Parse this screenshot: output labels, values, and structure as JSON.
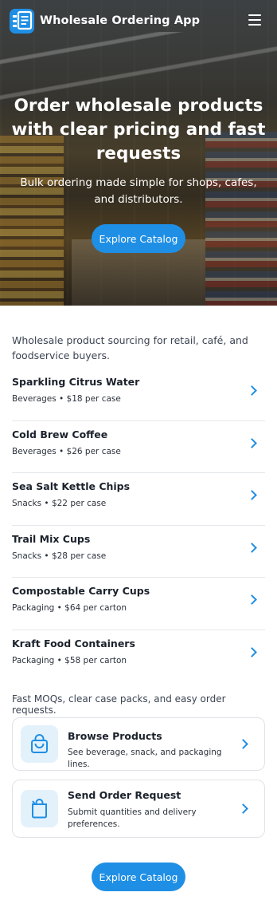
{
  "header": {
    "title": "Wholesale Ordering App",
    "logo_icon": "list-document-icon",
    "menu_icon": "hamburger-menu-icon"
  },
  "hero": {
    "title": "Order wholesale products with clear pricing and fast requests",
    "subtitle": "Bulk ordering made simple for shops, cafes, and distributors.",
    "cta_label": "Explore Catalog"
  },
  "intro": "Wholesale product sourcing for retail, café, and foodservice buyers.",
  "products": [
    {
      "name": "Sparkling Citrus Water",
      "meta": "Beverages • $18 per case"
    },
    {
      "name": "Cold Brew Coffee",
      "meta": "Beverages • $26 per case"
    },
    {
      "name": "Sea Salt Kettle Chips",
      "meta": "Snacks • $22 per case"
    },
    {
      "name": "Trail Mix Cups",
      "meta": "Snacks • $28 per case"
    },
    {
      "name": "Compostable Carry Cups",
      "meta": "Packaging • $64 per carton"
    },
    {
      "name": "Kraft Food Containers",
      "meta": "Packaging • $58 per carton"
    }
  ],
  "tagline": "Fast MOQs, clear case packs, and easy order requests.",
  "cards": [
    {
      "title": "Browse Products",
      "desc": "See beverage, snack, and packaging lines.",
      "icon": "lock-bag-icon"
    },
    {
      "title": "Send Order Request",
      "desc": "Submit quantities and delivery preferences.",
      "icon": "shopping-bag-icon"
    }
  ],
  "bottom_cta_label": "Explore Catalog",
  "colors": {
    "accent": "#1f8fe5",
    "icon_bg": "#e3f1fb",
    "divider": "#e4e7eb"
  }
}
